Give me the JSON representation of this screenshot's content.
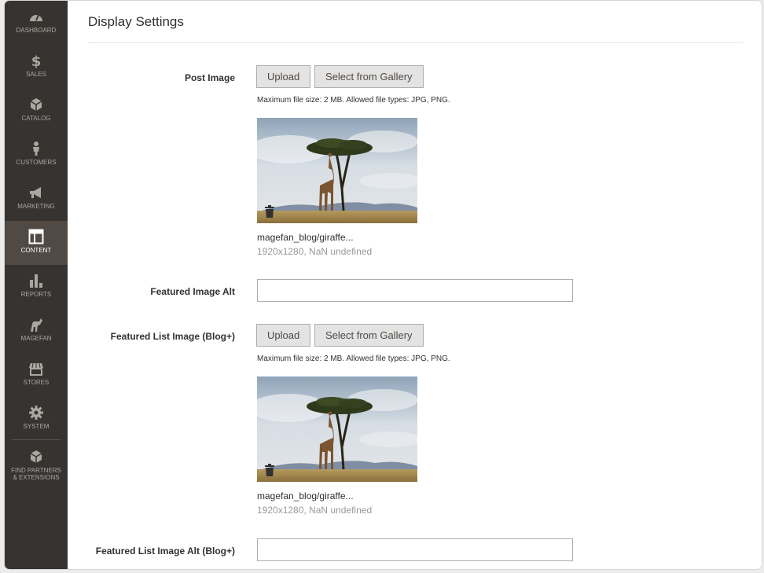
{
  "sidebar": {
    "items": [
      {
        "label": "DASHBOARD",
        "icon": "dashboard-icon"
      },
      {
        "label": "SALES",
        "icon": "dollar-icon"
      },
      {
        "label": "CATALOG",
        "icon": "box-icon"
      },
      {
        "label": "CUSTOMERS",
        "icon": "person-icon"
      },
      {
        "label": "MARKETING",
        "icon": "megaphone-icon"
      },
      {
        "label": "CONTENT",
        "icon": "layout-icon",
        "active": true
      },
      {
        "label": "REPORTS",
        "icon": "bar-chart-icon"
      },
      {
        "label": "MAGEFAN",
        "icon": "magefan-icon"
      },
      {
        "label": "STORES",
        "icon": "store-icon"
      },
      {
        "label": "SYSTEM",
        "icon": "gear-icon"
      }
    ],
    "partners": {
      "line1": "FIND PARTNERS",
      "line2": "& EXTENSIONS",
      "icon": "box-icon"
    }
  },
  "section": {
    "title": "Display Settings"
  },
  "post_image": {
    "label": "Post Image",
    "upload_label": "Upload",
    "gallery_label": "Select from Gallery",
    "note": "Maximum file size: 2 MB. Allowed file types: JPG, PNG.",
    "filename": "magefan_blog/giraffe...",
    "meta": "1920x1280, NaN undefined"
  },
  "featured_image_alt": {
    "label": "Featured Image Alt",
    "value": ""
  },
  "featured_list_image": {
    "label": "Featured List Image (Blog+)",
    "upload_label": "Upload",
    "gallery_label": "Select from Gallery",
    "note": "Maximum file size: 2 MB. Allowed file types: JPG, PNG.",
    "filename": "magefan_blog/giraffe...",
    "meta": "1920x1280, NaN undefined"
  },
  "featured_list_image_alt": {
    "label": "Featured List Image Alt (Blog+)",
    "value": ""
  },
  "colors": {
    "sidebar_bg": "#373330",
    "sidebar_active": "#514943",
    "button_bg": "#e3e3e3"
  }
}
